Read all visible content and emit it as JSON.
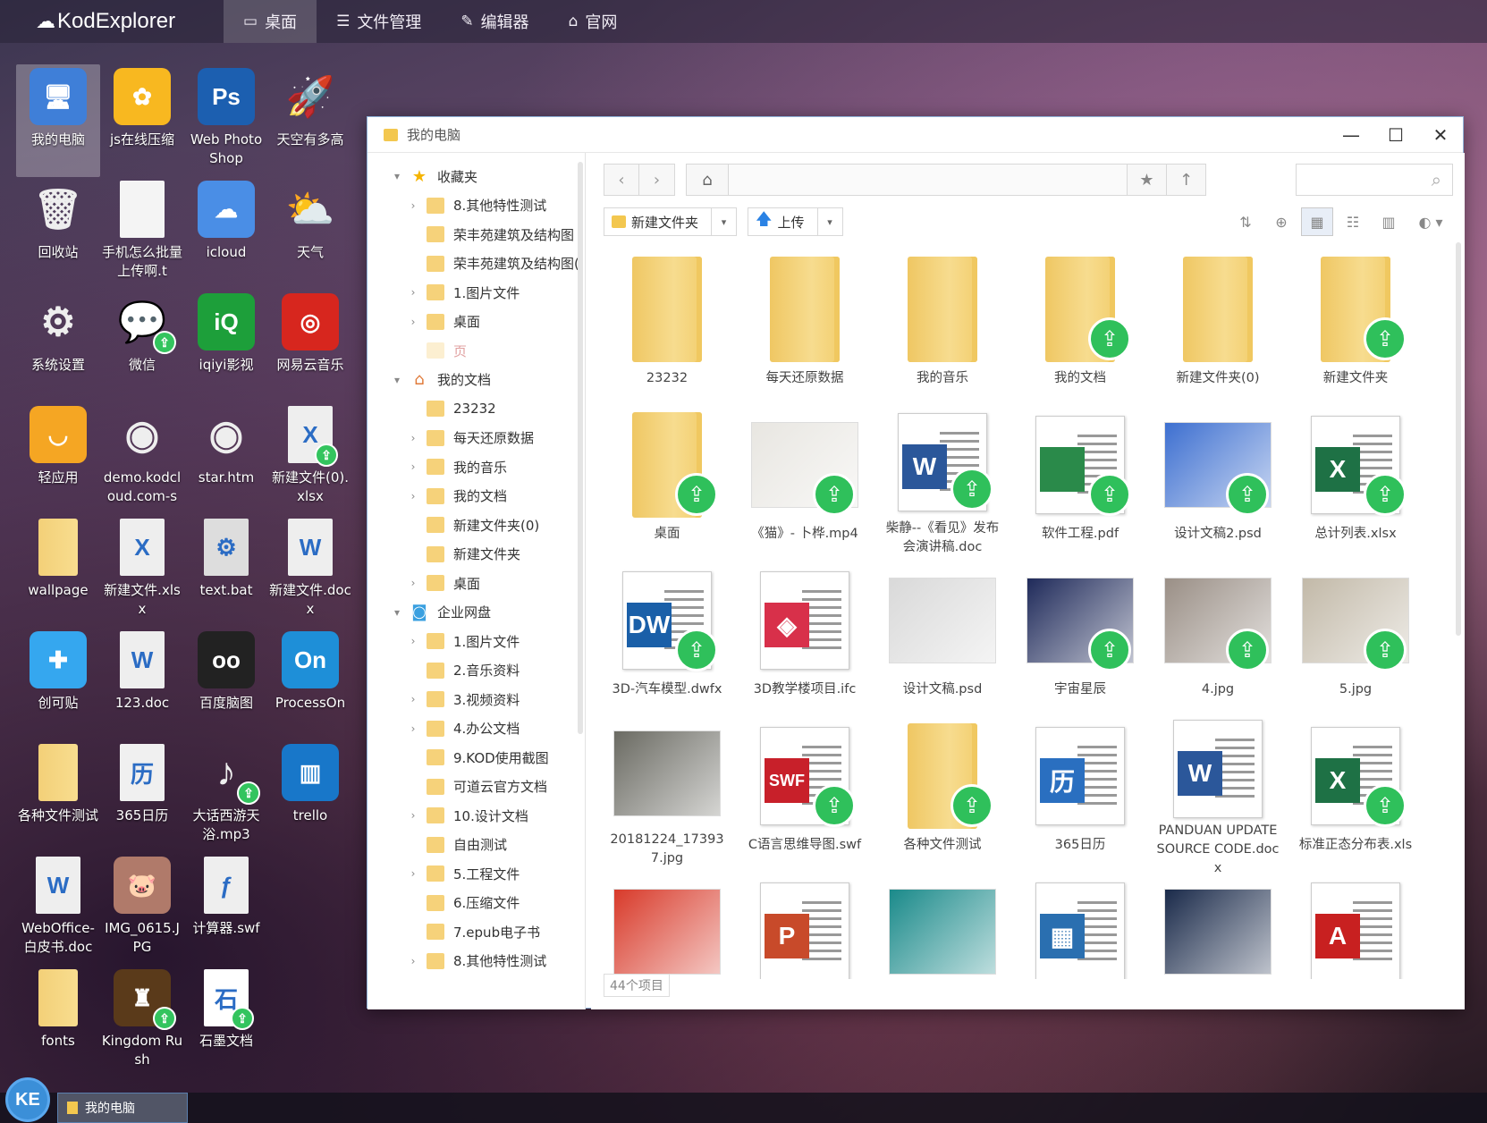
{
  "app": {
    "logo": "KodExplorer"
  },
  "nav": [
    {
      "label": "桌面",
      "icon": "monitor-icon",
      "active": true
    },
    {
      "label": "文件管理",
      "icon": "list-icon",
      "active": false
    },
    {
      "label": "编辑器",
      "icon": "edit-icon",
      "active": false
    },
    {
      "label": "官网",
      "icon": "home-icon",
      "active": false
    }
  ],
  "desktop": [
    {
      "label": "我的电脑",
      "icon": "computer-icon",
      "color": "#3f7fd8",
      "glyph": "🖥",
      "selected": true
    },
    {
      "label": "js在线压缩",
      "icon": "flower-icon",
      "color": "#f8b820",
      "glyph": "✿"
    },
    {
      "label": "Web Photo Shop",
      "icon": "photoshop-icon",
      "color": "#1c5fb0",
      "glyph": "Ps"
    },
    {
      "label": "天空有多高",
      "icon": "rocket-icon",
      "color": "transparent",
      "glyph": "🚀"
    },
    {
      "label": "回收站",
      "icon": "trash-icon",
      "color": "transparent",
      "glyph": "🗑"
    },
    {
      "label": "手机怎么批量上传啊.t",
      "icon": "text-file-icon",
      "color": "#f4f4f4",
      "glyph": ""
    },
    {
      "label": "icloud",
      "icon": "icloud-icon",
      "color": "#4a8ee6",
      "glyph": "☁"
    },
    {
      "label": "天气",
      "icon": "weather-icon",
      "color": "transparent",
      "glyph": "⛅"
    },
    {
      "label": "系统设置",
      "icon": "gear-icon",
      "color": "transparent",
      "glyph": "⚙"
    },
    {
      "label": "微信",
      "icon": "wechat-icon",
      "color": "transparent",
      "glyph": "💬",
      "shared": true
    },
    {
      "label": "iqiyi影视",
      "icon": "iqiyi-icon",
      "color": "#1d9f3a",
      "glyph": "iQ"
    },
    {
      "label": "网易云音乐",
      "icon": "netease-music-icon",
      "color": "#d7261e",
      "glyph": "◎"
    },
    {
      "label": "轻应用",
      "icon": "bag-icon",
      "color": "#f5a623",
      "glyph": "◡"
    },
    {
      "label": "demo.kodcloud.com-s",
      "icon": "chrome-icon",
      "color": "transparent",
      "glyph": "◉"
    },
    {
      "label": "star.htm",
      "icon": "chrome-icon",
      "color": "transparent",
      "glyph": "◉"
    },
    {
      "label": "新建文件(0).xlsx",
      "icon": "excel-icon",
      "color": "#eeeeee",
      "glyph": "X",
      "shared": true
    },
    {
      "label": "wallpage",
      "icon": "folder-icon",
      "folder": true
    },
    {
      "label": "新建文件.xlsx",
      "icon": "excel-icon",
      "color": "#eeeeee",
      "glyph": "X"
    },
    {
      "label": "text.bat",
      "icon": "bat-file-icon",
      "color": "#dddddd",
      "glyph": "⚙"
    },
    {
      "label": "新建文件.docx",
      "icon": "word-icon",
      "color": "#eeeeee",
      "glyph": "W"
    },
    {
      "label": "创可贴",
      "icon": "chuangkit-icon",
      "color": "#35a7ef",
      "glyph": "✚"
    },
    {
      "label": "123.doc",
      "icon": "word-icon",
      "color": "#eeeeee",
      "glyph": "W"
    },
    {
      "label": "百度脑图",
      "icon": "baidu-mindmap-icon",
      "color": "#222222",
      "glyph": "oo"
    },
    {
      "label": "ProcessOn",
      "icon": "processon-icon",
      "color": "#1e8fd8",
      "glyph": "On"
    },
    {
      "label": "各种文件测试",
      "icon": "folder-shortcut-icon",
      "folder": true
    },
    {
      "label": "365日历",
      "icon": "calendar-icon",
      "color": "#f0f0f0",
      "glyph": "历"
    },
    {
      "label": "大话西游天浴.mp3",
      "icon": "music-icon",
      "color": "transparent",
      "glyph": "♪",
      "shared": true
    },
    {
      "label": "trello",
      "icon": "trello-icon",
      "color": "#1877c9",
      "glyph": "▥"
    },
    {
      "label": "WebOffice-白皮书.doc",
      "icon": "word-icon",
      "color": "#eeeeee",
      "glyph": "W"
    },
    {
      "label": "IMG_0615.JPG",
      "icon": "image-icon",
      "color": "#b07a6a",
      "glyph": "🐷"
    },
    {
      "label": "计算器.swf",
      "icon": "flash-icon",
      "color": "#eeeeee",
      "glyph": "ƒ"
    },
    {
      "label": "",
      "icon": "empty-slot",
      "hidden": true
    },
    {
      "label": "fonts",
      "icon": "folder-shortcut-icon",
      "folder": true
    },
    {
      "label": "Kingdom Rush",
      "icon": "kingdom-rush-icon",
      "color": "#5a3a1a",
      "glyph": "♜",
      "shared": true
    },
    {
      "label": "石墨文档",
      "icon": "shimo-icon",
      "color": "#ffffff",
      "glyph": "石",
      "shared": true
    }
  ],
  "window": {
    "title": "我的电脑",
    "controls": {
      "minimize": "—",
      "maximize": "☐",
      "close": "✕"
    },
    "sidebar": [
      {
        "label": "收藏夹",
        "type": "group",
        "arrow": "▾",
        "icon": "star-icon",
        "glyph": "★",
        "glyph_color": "#f5b400"
      },
      {
        "label": "8.其他特性测试",
        "type": "folder",
        "arrow": "›"
      },
      {
        "label": "荣丰苑建筑及结构图",
        "type": "folder",
        "arrow": ""
      },
      {
        "label": "荣丰苑建筑及结构图(",
        "type": "folder",
        "arrow": ""
      },
      {
        "label": "1.图片文件",
        "type": "folder",
        "arrow": "›"
      },
      {
        "label": "桌面",
        "type": "folder",
        "arrow": "›"
      },
      {
        "label": "页",
        "type": "folder-faded",
        "arrow": ""
      },
      {
        "label": "我的文档",
        "type": "group",
        "arrow": "▾",
        "icon": "home-icon",
        "glyph": "⌂",
        "glyph_color": "#e07a3a"
      },
      {
        "label": "23232",
        "type": "folder",
        "arrow": ""
      },
      {
        "label": "每天还原数据",
        "type": "folder",
        "arrow": "›"
      },
      {
        "label": "我的音乐",
        "type": "folder",
        "arrow": "›"
      },
      {
        "label": "我的文档",
        "type": "folder",
        "arrow": "›"
      },
      {
        "label": "新建文件夹(0)",
        "type": "folder",
        "arrow": ""
      },
      {
        "label": "新建文件夹",
        "type": "folder",
        "arrow": ""
      },
      {
        "label": "桌面",
        "type": "folder",
        "arrow": "›"
      },
      {
        "label": "企业网盘",
        "type": "group",
        "arrow": "▾",
        "icon": "cloud-disk-icon",
        "glyph": "◙",
        "glyph_color": "#3aa0e0"
      },
      {
        "label": "1.图片文件",
        "type": "folder",
        "arrow": "›"
      },
      {
        "label": "2.音乐资料",
        "type": "folder",
        "arrow": ""
      },
      {
        "label": "3.视频资料",
        "type": "folder",
        "arrow": "›"
      },
      {
        "label": "4.办公文档",
        "type": "folder",
        "arrow": "›"
      },
      {
        "label": "9.KOD使用截图",
        "type": "folder",
        "arrow": ""
      },
      {
        "label": "可道云官方文档",
        "type": "folder",
        "arrow": ""
      },
      {
        "label": "10.设计文档",
        "type": "folder",
        "arrow": "›"
      },
      {
        "label": "自由测试",
        "type": "folder",
        "arrow": ""
      },
      {
        "label": "5.工程文件",
        "type": "folder",
        "arrow": "›"
      },
      {
        "label": "6.压缩文件",
        "type": "folder",
        "arrow": ""
      },
      {
        "label": "7.epub电子书",
        "type": "folder",
        "arrow": ""
      },
      {
        "label": "8.其他特性测试",
        "type": "folder",
        "arrow": "›"
      }
    ],
    "pathbar": {
      "back": "‹",
      "forward": "›",
      "home": "⌂",
      "star": "★",
      "up": "↑",
      "search": "⌕",
      "search_placeholder": ""
    },
    "toolbar": {
      "new_folder": "新建文件夹",
      "upload": "上传",
      "dropdown": "▾"
    },
    "files": [
      {
        "name": "23232",
        "kind": "folder"
      },
      {
        "name": "每天还原数据",
        "kind": "folder"
      },
      {
        "name": "我的音乐",
        "kind": "folder"
      },
      {
        "name": "我的文档",
        "kind": "folder",
        "shared": true
      },
      {
        "name": "新建文件夹(0)",
        "kind": "folder"
      },
      {
        "name": "新建文件夹",
        "kind": "folder",
        "shared": true
      },
      {
        "name": "桌面",
        "kind": "folder",
        "shared": true
      },
      {
        "name": "《猫》- 卜桦.mp4",
        "kind": "image",
        "bg": "#e8e6e1",
        "shared": true
      },
      {
        "name": "柴静--《看见》发布会演讲稿.doc",
        "kind": "doc",
        "letter": "W",
        "color": "#2b579a",
        "shared": true
      },
      {
        "name": "软件工程.pdf",
        "kind": "doc",
        "letter": "",
        "color": "#2a8a4a",
        "shared": true
      },
      {
        "name": "设计文稿2.psd",
        "kind": "image",
        "bg": "#3d6fd0",
        "shared": true
      },
      {
        "name": "总计列表.xlsx",
        "kind": "doc",
        "letter": "X",
        "color": "#1e7145",
        "shared": true
      },
      {
        "name": "3D-汽车模型.dwfx",
        "kind": "doc",
        "letter": "DW",
        "color": "#1a5fa8",
        "shared": true
      },
      {
        "name": "3D教学楼项目.ifc",
        "kind": "doc",
        "letter": "◈",
        "color": "#d8304a"
      },
      {
        "name": "设计文稿.psd",
        "kind": "image",
        "bg": "#d9d9d9"
      },
      {
        "name": "宇宙星辰",
        "kind": "image",
        "bg": "#1f2a5a",
        "shared": true
      },
      {
        "name": "4.jpg",
        "kind": "image",
        "bg": "#9a8f86",
        "shared": true
      },
      {
        "name": "5.jpg",
        "kind": "image",
        "bg": "#c2b9a8",
        "shared": true
      },
      {
        "name": "20181224_173937.jpg",
        "kind": "image",
        "bg": "#6a6a62"
      },
      {
        "name": "C语言思维导图.swf",
        "kind": "doc",
        "letter": "SWF",
        "color": "#c8202a",
        "shared": true
      },
      {
        "name": "各种文件测试",
        "kind": "folder",
        "shared": true
      },
      {
        "name": "365日历",
        "kind": "doc",
        "letter": "历",
        "color": "#2a6fc0"
      },
      {
        "name": "PANDUAN UPDATE SOURCE CODE.docx",
        "kind": "doc",
        "letter": "W",
        "color": "#2b579a"
      },
      {
        "name": "标准正态分布表.xls",
        "kind": "doc",
        "letter": "X",
        "color": "#1e7145",
        "shared": true
      },
      {
        "name": "",
        "kind": "image",
        "bg": "#d83a2a"
      },
      {
        "name": "",
        "kind": "doc",
        "letter": "P",
        "color": "#c84a2a"
      },
      {
        "name": "",
        "kind": "image",
        "bg": "#1a8a8a"
      },
      {
        "name": "",
        "kind": "doc",
        "letter": "▦",
        "color": "#2a6fb0"
      },
      {
        "name": "",
        "kind": "image",
        "bg": "#1a2a4a"
      },
      {
        "name": "",
        "kind": "doc",
        "letter": "A",
        "color": "#c82020"
      }
    ],
    "item_count": "44个项目"
  },
  "taskbar": {
    "start": "KE",
    "task": "我的电脑"
  }
}
